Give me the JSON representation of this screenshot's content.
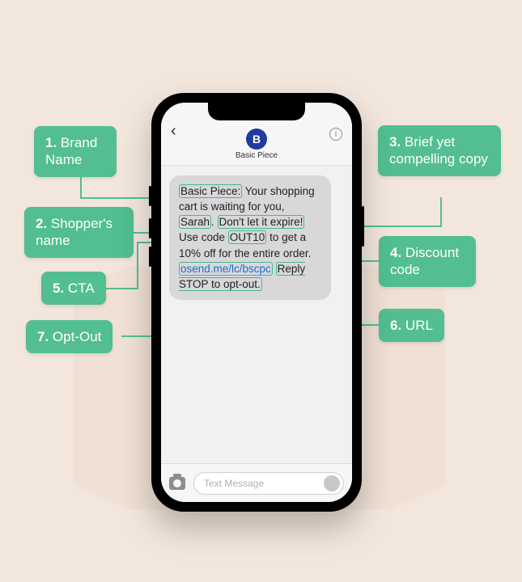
{
  "contact": {
    "initial": "B",
    "name": "Basic Piece"
  },
  "message": {
    "brand": "Basic Piece:",
    "copy1": " Your shopping cart is waiting for you, ",
    "shopper": "Sarah",
    "copy2": ". ",
    "pitch": "Don't let it expire!",
    "copy3": " Use code ",
    "code": "OUT10",
    "copy4": " to get a 10% off for the entire order. ",
    "url": "osend.me/lc/bscpc",
    "copy5": " ",
    "optout": "Reply STOP to opt-out."
  },
  "input": {
    "placeholder": "Text Message"
  },
  "callouts": {
    "c1": {
      "num": "1.",
      "label": "Brand Name"
    },
    "c2": {
      "num": "2.",
      "label": "Shopper's name"
    },
    "c3": {
      "num": "3.",
      "label": "Brief yet compelling copy"
    },
    "c4": {
      "num": "4.",
      "label": "Discount code"
    },
    "c5": {
      "num": "5.",
      "label": "CTA"
    },
    "c6": {
      "num": "6.",
      "label": "URL"
    },
    "c7": {
      "num": "7.",
      "label": "Opt-Out"
    }
  }
}
